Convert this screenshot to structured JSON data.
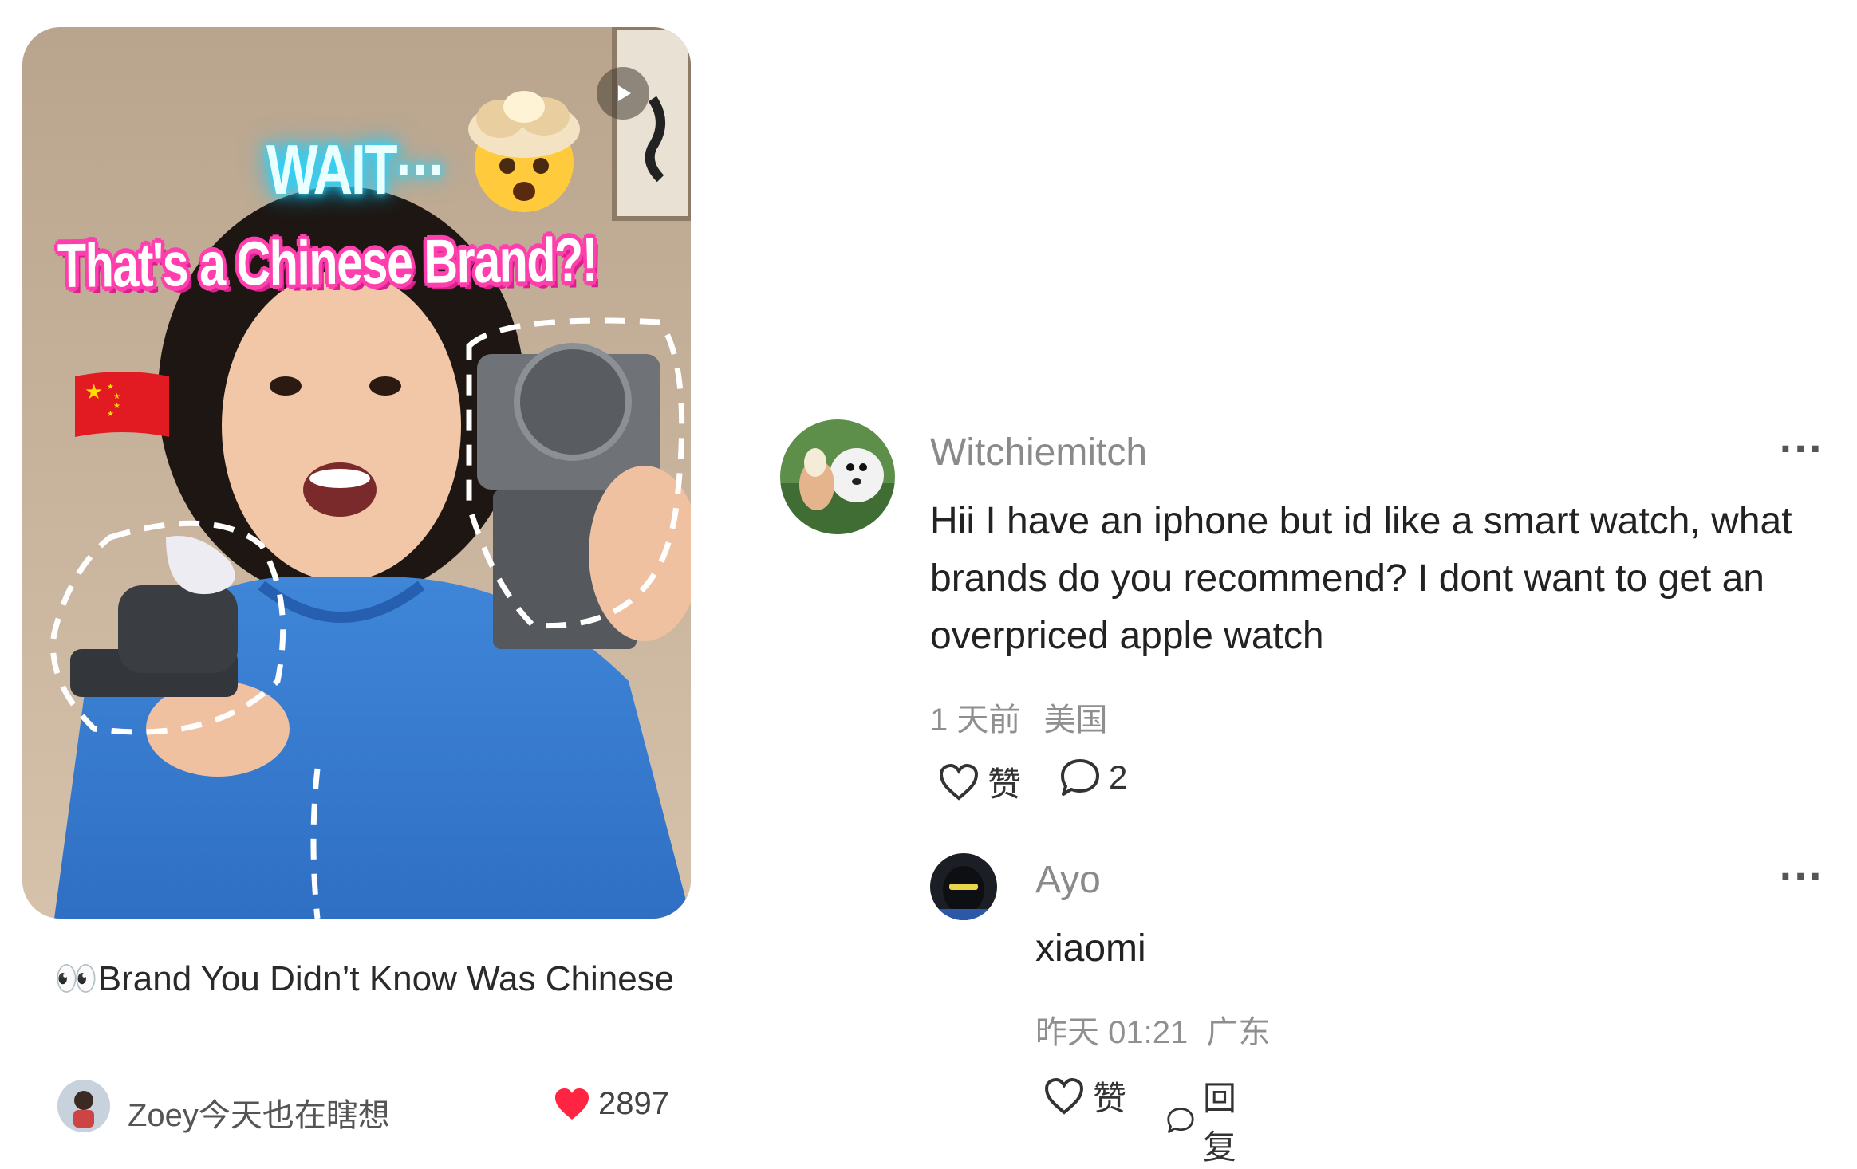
{
  "post": {
    "overlay_wait": "WAIT···",
    "overlay_headline": "That's a Chinese Brand?!",
    "title": "👀Brand You Didn’t Know Was Chinese",
    "author": "Zoey今天也在瞎想",
    "likes": "2897",
    "icons": {
      "play": "play-icon",
      "like": "heart-filled-icon",
      "flag": "china-flag-icon",
      "emoji": "exploding-head-emoji"
    },
    "colors": {
      "like": "#ff2442",
      "headline_outline": "#ff3fae",
      "wait_glow": "#27d8ff"
    }
  },
  "comments": [
    {
      "user": "Witchiemitch",
      "text": "Hii I have an iphone but id like a smart watch, what brands do you recommend? I dont want to get an overpriced apple watch",
      "time": "1 天前",
      "location": "美国",
      "like_label": "赞",
      "reply_count": "2",
      "more": "···"
    },
    {
      "user": "Ayo",
      "text": "xiaomi",
      "time": "昨天 01:21",
      "location": "广东",
      "like_label": "赞",
      "reply_label": "回复",
      "more": "···"
    }
  ]
}
